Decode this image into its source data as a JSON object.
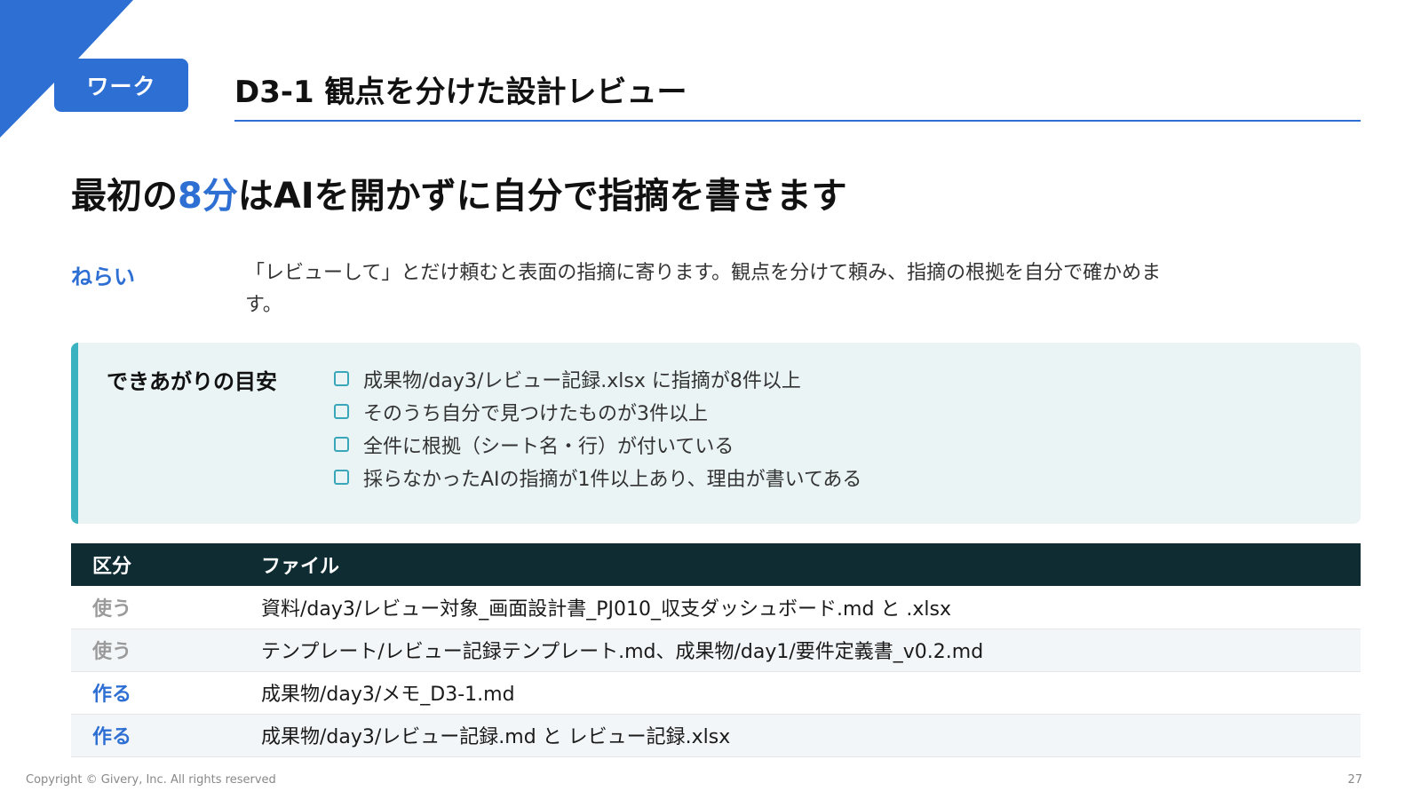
{
  "header": {
    "tag": "ワーク",
    "title": "D3-1 観点を分けた設計レビュー",
    "accent_color": "#2e6fd4"
  },
  "headline": {
    "before": "最初の",
    "highlight": "8分",
    "after": "はAIを開かずに自分で指摘を書きます"
  },
  "aim": {
    "label": "ねらい",
    "text": "「レビューして」とだけ頼むと表面の指摘に寄ります。観点を分けて頼み、指摘の根拠を自分で確かめます。"
  },
  "criteria": {
    "label": "できあがりの目安",
    "items": [
      "成果物/day3/レビュー記録.xlsx に指摘が8件以上",
      "そのうち自分で見つけたものが3件以上",
      "全件に根拠（シート名・行）が付いている",
      "採らなかったAIの指摘が1件以上あり、理由が書いてある"
    ]
  },
  "files_table": {
    "headers": [
      "区分",
      "ファイル"
    ],
    "rows": [
      {
        "kind": "使う",
        "type": "use",
        "file": "資料/day3/レビュー対象_画面設計書_PJ010_収支ダッシュボード.md と .xlsx"
      },
      {
        "kind": "使う",
        "type": "use",
        "file": "テンプレート/レビュー記録テンプレート.md、成果物/day1/要件定義書_v0.2.md"
      },
      {
        "kind": "作る",
        "type": "make",
        "file": "成果物/day3/メモ_D3-1.md"
      },
      {
        "kind": "作る",
        "type": "make",
        "file": "成果物/day3/レビュー記録.md と レビュー記録.xlsx"
      }
    ]
  },
  "footer": {
    "copyright": "Copyright © Givery, Inc. All rights reserved",
    "page": "27"
  }
}
